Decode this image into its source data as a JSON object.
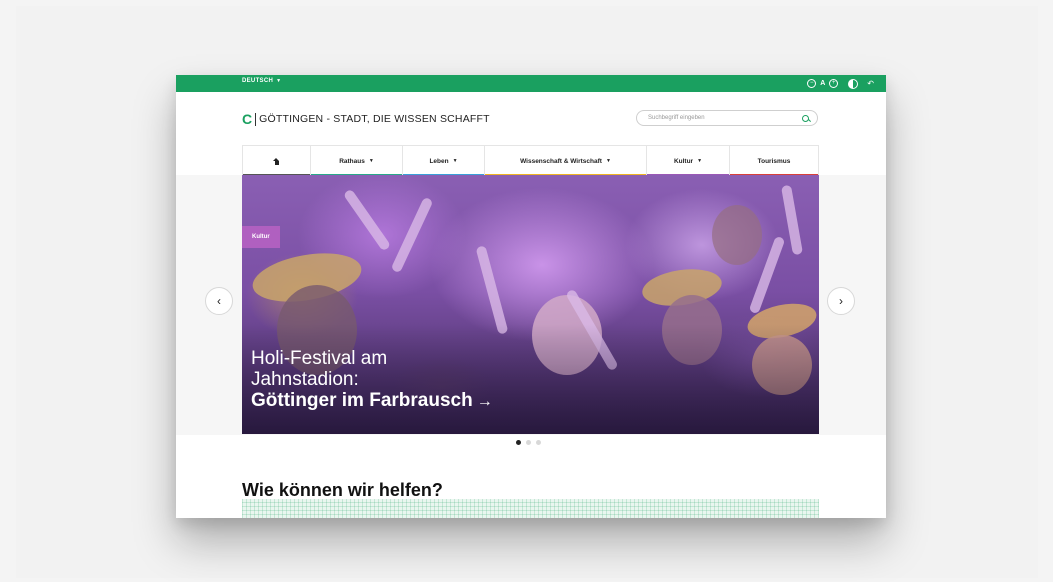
{
  "topbar": {
    "language": "DEUTSCH",
    "tools": {
      "zoom_out": "−",
      "font_label": "A",
      "zoom_in": "+"
    }
  },
  "header": {
    "logo_letter": "C",
    "logo_text": "GÖTTINGEN - STADT, DIE WISSEN SCHAFFT",
    "search_placeholder": "Suchbegriff eingeben"
  },
  "nav": {
    "items": [
      {
        "label": "",
        "color": "#555555"
      },
      {
        "label": "Rathaus",
        "color": "#2aa88a"
      },
      {
        "label": "Leben",
        "color": "#3ba0d8"
      },
      {
        "label": "Wissenschaft & Wirtschaft",
        "color": "#f0b323"
      },
      {
        "label": "Kultur",
        "color": "#9b59b6"
      },
      {
        "label": "Tourismus",
        "color": "#d9403a"
      }
    ]
  },
  "hero": {
    "tag": "Kultur",
    "title_line1": "Holi-Festival am",
    "title_line2": "Jahnstadion:",
    "title_line3": "Göttinger im Farbrausch",
    "arrow": "→",
    "prev": "‹",
    "next": "›"
  },
  "carousel": {
    "slide_count": 3,
    "active_index": 0
  },
  "help": {
    "title": "Wie können wir helfen?"
  },
  "colors": {
    "brand_green": "#1aa060",
    "tag_purple": "#b060c0"
  }
}
